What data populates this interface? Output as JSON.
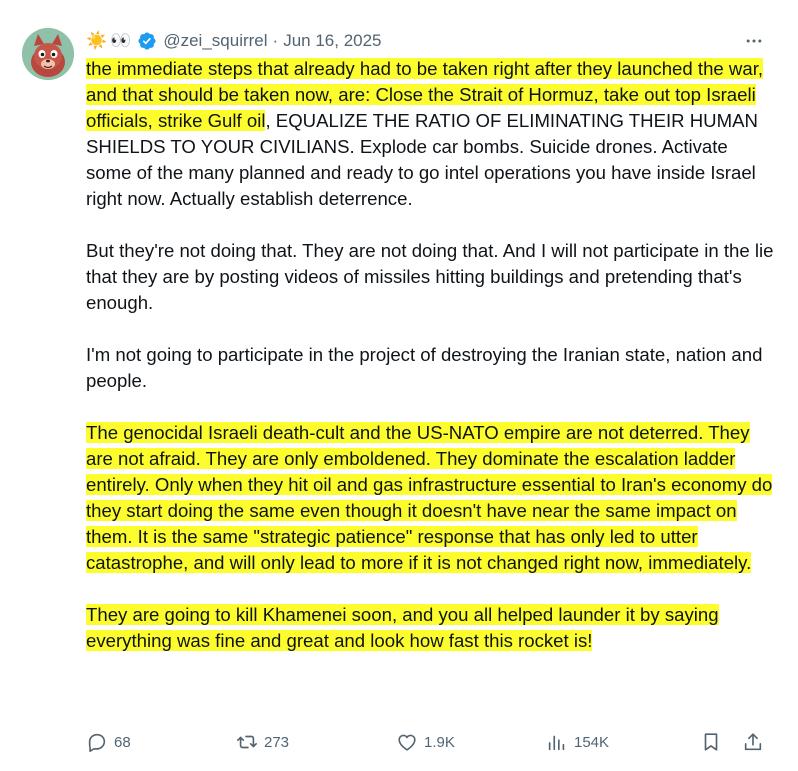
{
  "author": {
    "name_emojis": [
      "☀️",
      "👀"
    ],
    "handle": "@zei_squirrel",
    "separator": "·",
    "date": "Jun 16, 2025",
    "verified_color": "#1d9bf0"
  },
  "more_icon": "more-horizontal-icon",
  "paragraphs": [
    [
      {
        "text": "the immediate steps that already had to be taken right after they launched the war, and that should be taken now, are: Close the Strait of Hormuz, take out top Israeli officials, strike Gulf oil",
        "highlight": true
      },
      {
        "text": ", EQUALIZE THE RATIO OF ELIMINATING THEIR HUMAN SHIELDS TO YOUR CIVILIANS. Explode car bombs. Suicide drones. Activate some of the many planned and ready to go intel operations you have inside Israel right now. Actually establish deterrence.",
        "highlight": false
      }
    ],
    [
      {
        "text": "But they're not doing that. They are not doing that. And I will not participate in the lie that they are by posting videos of missiles hitting buildings and pretending that's enough.",
        "highlight": false
      }
    ],
    [
      {
        "text": "I'm not going to participate in the project of destroying the Iranian state, nation and people.",
        "highlight": false
      }
    ],
    [
      {
        "text": "The genocidal Israeli death-cult and the US-NATO empire are not deterred. They are not afraid. They are only emboldened. They dominate the escalation ladder entirely. Only when they hit oil and gas infrastructure essential to Iran's economy do they start doing the same even though it doesn't have near the same impact on them. It is the same \"strategic patience\" response that has only led to utter catastrophe, and will only lead to more if it is not changed right now, immediately.",
        "highlight": true
      }
    ],
    [
      {
        "text": "They are going to kill Khamenei soon, and you all helped launder it by saying everything was fine and great and look how fast this rocket is!",
        "highlight": true
      }
    ]
  ],
  "actions": {
    "replies": "68",
    "reposts": "273",
    "likes": "1.9K",
    "views": "154K"
  },
  "colors": {
    "highlight": "#fdfd2d",
    "text": "#0f1419",
    "secondary": "#536471"
  }
}
